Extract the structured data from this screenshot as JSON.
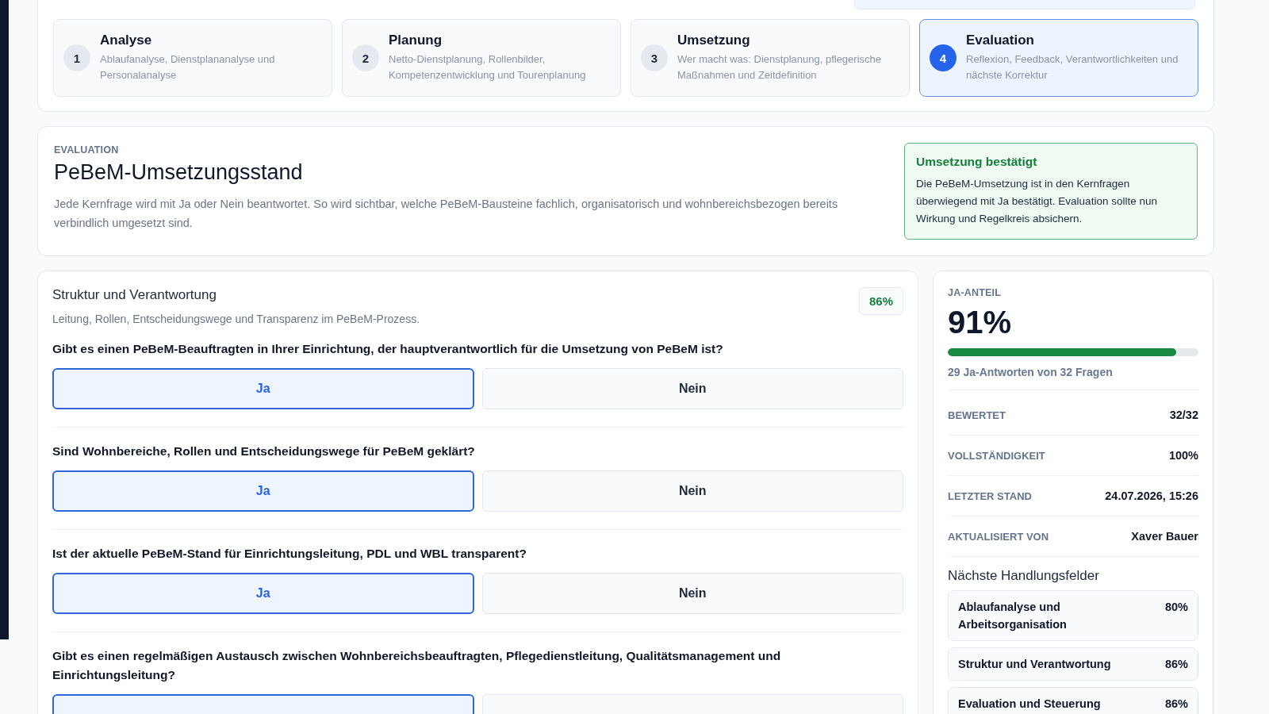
{
  "steps": [
    {
      "number": "1",
      "title": "Analyse",
      "description": "Ablaufanalyse, Dienstplananalyse und Personalanalyse",
      "selected": false
    },
    {
      "number": "2",
      "title": "Planung",
      "description": "Netto-Dienstplanung, Rollenbilder, Kompetenzentwicklung und Tourenplanung",
      "selected": false
    },
    {
      "number": "3",
      "title": "Umsetzung",
      "description": "Wer macht was: Dienstplanung, pflegerische Maßnahmen und Zeitdefinition",
      "selected": false
    },
    {
      "number": "4",
      "title": "Evaluation",
      "description": "Reflexion, Feedback, Verantwortlichkeiten und nächste Korrektur",
      "selected": true
    }
  ],
  "header": {
    "eyebrow": "EVALUATION",
    "title": "PeBeM-Umsetzungsstand",
    "description": "Jede Kernfrage wird mit Ja oder Nein beantwortet. So wird sichtbar, welche PeBeM-Bausteine fachlich, organisatorisch und wohnbereichsbezogen bereits verbindlich umgesetzt sind.",
    "status": {
      "title": "Umsetzung bestätigt",
      "text": "Die PeBeM-Umsetzung ist in den Kernfragen überwiegend mit Ja bestätigt. Evaluation sollte nun Wirkung und Regelkreis absichern."
    }
  },
  "section": {
    "title": "Struktur und Verantwortung",
    "subtitle": "Leitung, Rollen, Entscheidungswege und Transparenz im PeBeM-Prozess.",
    "score": "86%",
    "questions": [
      {
        "text": "Gibt es einen PeBeM-Beauftragten in Ihrer Einrichtung, der hauptverantwortlich für die Umsetzung von PeBeM ist?",
        "answers": [
          {
            "label": "Ja",
            "selected": true
          },
          {
            "label": "Nein",
            "selected": false
          }
        ]
      },
      {
        "text": "Sind Wohnbereiche, Rollen und Entscheidungswege für PeBeM geklärt?",
        "answers": [
          {
            "label": "Ja",
            "selected": true
          },
          {
            "label": "Nein",
            "selected": false
          }
        ]
      },
      {
        "text": "Ist der aktuelle PeBeM-Stand für Einrichtungsleitung, PDL und WBL transparent?",
        "answers": [
          {
            "label": "Ja",
            "selected": true
          },
          {
            "label": "Nein",
            "selected": false
          }
        ]
      },
      {
        "text": "Gibt es einen regelmäßigen Austausch zwischen Wohnbereichsbeauftragten, Pflegedienstleitung, Qualitätsmanagement und Einrichtungsleitung?",
        "answers": [
          {
            "selected": true
          },
          {
            "selected": false
          }
        ]
      }
    ]
  },
  "summary": {
    "label": "JA-ANTEIL",
    "value": "91%",
    "level": 0.91,
    "caption": "29 Ja-Antworten von 32 Fragen",
    "stats": [
      {
        "label": "BEWERTET",
        "value": "32/32"
      },
      {
        "label": "VOLLSTÄNDIGKEIT",
        "value": "100%"
      },
      {
        "label": "LETZTER STAND",
        "value": "24.07.2026, 15:26"
      },
      {
        "label": "AKTUALISIERT VON",
        "value": "Xaver Bauer"
      }
    ],
    "next_title": "Nächste Handlungsfelder",
    "next": [
      {
        "title": "Ablaufanalyse und Arbeitsorganisation",
        "value": "80%"
      },
      {
        "title": "Struktur und Verantwortung",
        "value": "86%"
      },
      {
        "title": "Evaluation und Steuerung",
        "value": "86%"
      }
    ]
  }
}
